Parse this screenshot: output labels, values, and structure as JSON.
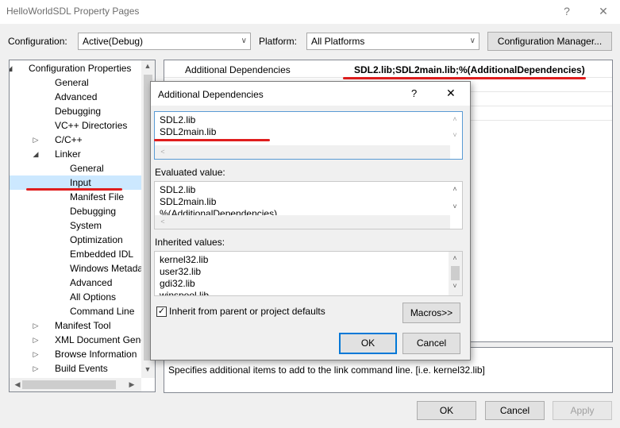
{
  "window": {
    "title": "HelloWorldSDL Property Pages",
    "help": "?",
    "close": "✕"
  },
  "header": {
    "configuration_label": "Configuration:",
    "configuration_value": "Active(Debug)",
    "platform_label": "Platform:",
    "platform_value": "All Platforms",
    "config_manager_label": "Configuration Manager..."
  },
  "tree": {
    "items": [
      {
        "label": "Configuration Properties",
        "expander": "◢",
        "level": 0
      },
      {
        "label": "General",
        "level": 1
      },
      {
        "label": "Advanced",
        "level": 1
      },
      {
        "label": "Debugging",
        "level": 1
      },
      {
        "label": "VC++ Directories",
        "level": 1
      },
      {
        "label": "C/C++",
        "expander": "▷",
        "level": 1
      },
      {
        "label": "Linker",
        "expander": "◢",
        "level": 1
      },
      {
        "label": "General",
        "level": 2
      },
      {
        "label": "Input",
        "level": 2,
        "selected": true
      },
      {
        "label": "Manifest File",
        "level": 2
      },
      {
        "label": "Debugging",
        "level": 2
      },
      {
        "label": "System",
        "level": 2
      },
      {
        "label": "Optimization",
        "level": 2
      },
      {
        "label": "Embedded IDL",
        "level": 2
      },
      {
        "label": "Windows Metadata",
        "level": 2
      },
      {
        "label": "Advanced",
        "level": 2
      },
      {
        "label": "All Options",
        "level": 2
      },
      {
        "label": "Command Line",
        "level": 2
      },
      {
        "label": "Manifest Tool",
        "expander": "▷",
        "level": 1
      },
      {
        "label": "XML Document Genera",
        "expander": "▷",
        "level": 1
      },
      {
        "label": "Browse Information",
        "expander": "▷",
        "level": 1
      },
      {
        "label": "Build Events",
        "expander": "▷",
        "level": 1
      }
    ]
  },
  "grid": {
    "property_name": "Additional Dependencies",
    "property_value": "SDL2.lib;SDL2main.lib;%(AdditionalDependencies)"
  },
  "description": "Specifies additional items to add to the link command line. [i.e. kernel32.lib]",
  "footer": {
    "ok": "OK",
    "cancel": "Cancel",
    "apply": "Apply"
  },
  "dialog": {
    "title": "Additional Dependencies",
    "help": "?",
    "close": "✕",
    "edit_lines": [
      "SDL2.lib",
      "SDL2main.lib"
    ],
    "evaluated_label": "Evaluated value:",
    "evaluated_lines": [
      "SDL2.lib",
      "SDL2main.lib",
      "%(AdditionalDependencies)"
    ],
    "inherited_label": "Inherited values:",
    "inherited_lines": [
      "kernel32.lib",
      "user32.lib",
      "gdi32.lib",
      "winspool.lib"
    ],
    "inherit_checkbox_label": "Inherit from parent or project defaults",
    "inherit_checked": true,
    "macros_label": "Macros>>",
    "ok": "OK",
    "cancel": "Cancel"
  },
  "colors": {
    "annotation_red": "#e01e1e",
    "selection": "#cce8ff",
    "focus_blue": "#0078d7"
  }
}
